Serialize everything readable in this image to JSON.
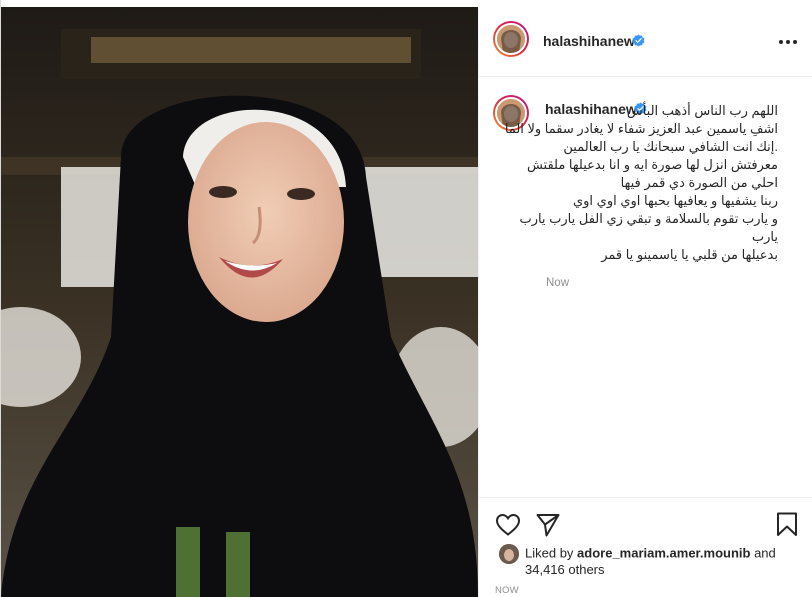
{
  "post": {
    "username": "halashihanew",
    "verified": true,
    "caption_lines": [
      "اللهم رب الناس أذهب البأس",
      "اشفِ ياسمين عبد العزيز شفاء لا يغادر سقما ولا الما",
      ".إنك انت الشافي سبحانك يا رب العالمين",
      "معرفتش انزل لها صورة ايه و انا بدعيلها ملقتش",
      "احلي من الصورة دي قمر فيها",
      "ربنا يشفيها و يعافيها بحبها اوي اوي اوي",
      "و يارب تقوم بالسلامة و تبقي زي الفل يارب يارب",
      "يارب",
      "بدعيلها من قلبي يا ياسمينو يا قمر"
    ],
    "caption_time": "Now",
    "liked_by_prefix": "Liked by ",
    "liked_by_user": "adore_mariam.amer.mounib",
    "liked_by_suffix": " and",
    "others": "34,416 others",
    "timestamp": "NOW"
  },
  "icons": {
    "more": "more-options-icon",
    "like": "heart-icon",
    "share": "share-icon",
    "save": "bookmark-icon",
    "verified": "verified-badge-icon"
  },
  "colors": {
    "verified": "#3897f0",
    "text": "#262626",
    "muted": "#8e8e8e",
    "border": "#efefef"
  }
}
